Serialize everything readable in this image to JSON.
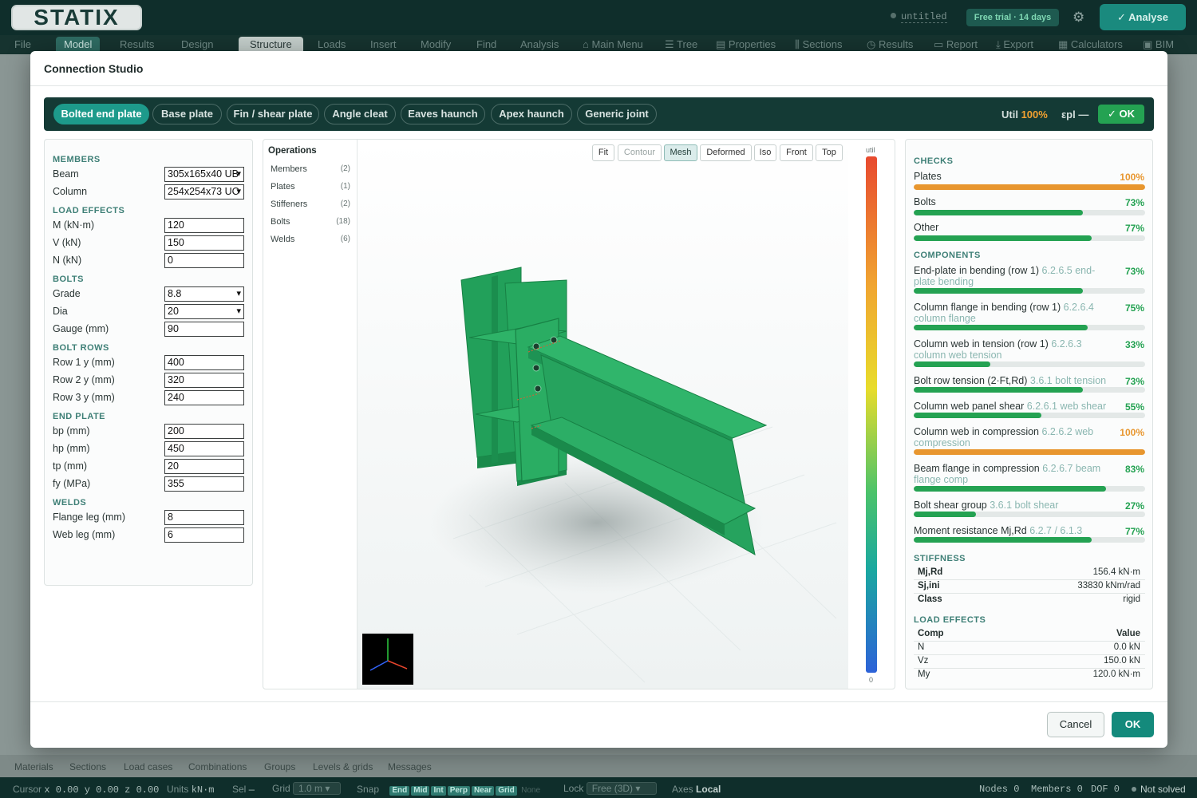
{
  "app": {
    "logo": "STATIX",
    "project_name": "untitled",
    "trial_badge": "Free trial · 14 days",
    "analyse_label": "Analyse"
  },
  "menubar": {
    "file": "File",
    "modes": [
      "Model",
      "Results",
      "Design"
    ],
    "tabs": [
      "Structure",
      "Loads",
      "Insert",
      "Modify",
      "Find",
      "Analysis"
    ],
    "tools": [
      "Main Menu",
      "Tree",
      "Properties",
      "Sections",
      "Results",
      "Report",
      "Export",
      "Calculators",
      "BIM"
    ]
  },
  "bottom_tabs": [
    "Materials",
    "Sections",
    "Load cases",
    "Combinations",
    "Groups",
    "Levels & grids",
    "Messages"
  ],
  "statusbar": {
    "cursor_label": "Cursor",
    "cursor_value": "x 0.00 y 0.00 z 0.00",
    "units_label": "Units",
    "units_value": "kN·m",
    "sel_label": "Sel",
    "sel_value": "—",
    "grid_label": "Grid",
    "grid_value": "1.0 m",
    "snap_label": "Snap",
    "snap_options": [
      "End",
      "Mid",
      "Int",
      "Perp",
      "Near",
      "Grid"
    ],
    "snap_none": "None",
    "lock_label": "Lock",
    "lock_value": "Free (3D)",
    "axes_label": "Axes",
    "axes_value": "Local",
    "nodes": "Nodes 0",
    "members": "Members 0",
    "dof": "DOF 0",
    "solve_state": "Not solved"
  },
  "modal": {
    "title": "Connection Studio",
    "connection_types": [
      "Bolted end plate",
      "Base plate",
      "Fin / shear plate",
      "Angle cleat",
      "Eaves haunch",
      "Apex haunch",
      "Generic joint"
    ],
    "active_type": "Bolted end plate",
    "util_label": "Util",
    "util_value": "100%",
    "epl_label": "εpl",
    "epl_value": "—",
    "status_chip": "✓ OK",
    "cancel_label": "Cancel",
    "ok_label": "OK"
  },
  "inputs": {
    "members_h": "MEMBERS",
    "beam_l": "Beam",
    "beam_v": "305x165x40 UB",
    "column_l": "Column",
    "column_v": "254x254x73 UC",
    "load_h": "LOAD EFFECTS",
    "m_l": "M (kN·m)",
    "m_v": "120",
    "v_l": "V (kN)",
    "v_v": "150",
    "n_l": "N (kN)",
    "n_v": "0",
    "bolts_h": "BOLTS",
    "grade_l": "Grade",
    "grade_v": "8.8",
    "dia_l": "Dia",
    "dia_v": "20",
    "gauge_l": "Gauge (mm)",
    "gauge_v": "90",
    "rows_h": "BOLT ROWS",
    "r1_l": "Row 1 y (mm)",
    "r1_v": "400",
    "r2_l": "Row 2 y (mm)",
    "r2_v": "320",
    "r3_l": "Row 3 y (mm)",
    "r3_v": "240",
    "ep_h": "END PLATE",
    "bp_l": "bp (mm)",
    "bp_v": "200",
    "hp_l": "hp (mm)",
    "hp_v": "450",
    "tp_l": "tp (mm)",
    "tp_v": "20",
    "fy_l": "fy (MPa)",
    "fy_v": "355",
    "welds_h": "WELDS",
    "wf_l": "Flange leg (mm)",
    "wf_v": "8",
    "ww_l": "Web leg (mm)",
    "ww_v": "6"
  },
  "viewer": {
    "ops_title": "Operations",
    "ops": [
      {
        "label": "Members",
        "count": "(2)"
      },
      {
        "label": "Plates",
        "count": "(1)"
      },
      {
        "label": "Stiffeners",
        "count": "(2)"
      },
      {
        "label": "Bolts",
        "count": "(18)"
      },
      {
        "label": "Welds",
        "count": "(6)"
      }
    ],
    "view_buttons": [
      "Fit",
      "Contour",
      "Mesh",
      "Deformed",
      "Iso",
      "Front",
      "Top"
    ],
    "active_view": "Mesh",
    "legend_top": "util",
    "legend_bottom": "0",
    "model_color": "#23a059"
  },
  "checks": {
    "checks_h": "CHECKS",
    "summary": [
      {
        "name": "Plates",
        "pct": "100%",
        "value": 1.0,
        "warn": true
      },
      {
        "name": "Bolts",
        "pct": "73%",
        "value": 0.73,
        "warn": false
      },
      {
        "name": "Other",
        "pct": "77%",
        "value": 0.77,
        "warn": false
      }
    ],
    "components_h": "COMPONENTS",
    "components": [
      {
        "name": "End-plate in bending (row 1)",
        "ref": "6.2.6.5 end-plate bending",
        "pct": "73%",
        "value": 0.73,
        "warn": false
      },
      {
        "name": "Column flange in bending (row 1)",
        "ref": "6.2.6.4 column flange",
        "pct": "75%",
        "value": 0.75,
        "warn": false
      },
      {
        "name": "Column web in tension (row 1)",
        "ref": "6.2.6.3 column web tension",
        "pct": "33%",
        "value": 0.33,
        "warn": false
      },
      {
        "name": "Bolt row tension (2·Ft,Rd)",
        "ref": "3.6.1 bolt tension",
        "pct": "73%",
        "value": 0.73,
        "warn": false
      },
      {
        "name": "Column web panel shear",
        "ref": "6.2.6.1 web shear",
        "pct": "55%",
        "value": 0.55,
        "warn": false
      },
      {
        "name": "Column web in compression",
        "ref": "6.2.6.2 web compression",
        "pct": "100%",
        "value": 1.0,
        "warn": true
      },
      {
        "name": "Beam flange in compression",
        "ref": "6.2.6.7 beam flange comp",
        "pct": "83%",
        "value": 0.83,
        "warn": false
      },
      {
        "name": "Bolt shear group",
        "ref": "3.6.1 bolt shear",
        "pct": "27%",
        "value": 0.27,
        "warn": false
      },
      {
        "name": "Moment resistance Mj,Rd",
        "ref": "6.2.7 / 6.1.3",
        "pct": "77%",
        "value": 0.77,
        "warn": false
      }
    ],
    "stiffness_h": "STIFFNESS",
    "stiffness": [
      {
        "k": "Mj,Rd",
        "v": "156.4 kN·m"
      },
      {
        "k": "Sj,ini",
        "v": "33830 kNm/rad"
      },
      {
        "k": "Class",
        "v": "rigid"
      }
    ],
    "loads_h": "LOAD EFFECTS",
    "loads_head": {
      "k": "Comp",
      "v": "Value"
    },
    "loads": [
      {
        "k": "N",
        "v": "0.0 kN"
      },
      {
        "k": "Vz",
        "v": "150.0 kN"
      },
      {
        "k": "My",
        "v": "120.0 kN·m"
      }
    ]
  }
}
